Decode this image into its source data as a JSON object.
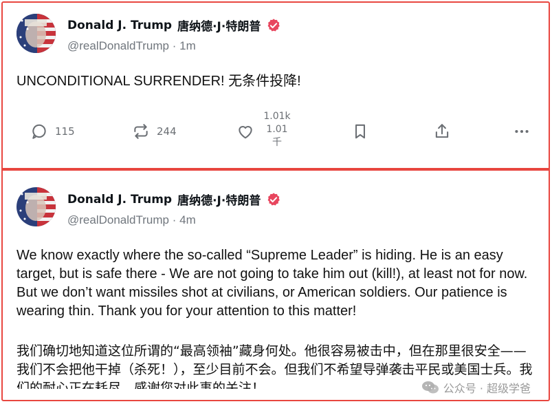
{
  "posts": [
    {
      "author": {
        "display_name": "Donald J. Trump",
        "display_name_zh": "唐纳德·J·特朗普",
        "handle": "@realDonaldTrump",
        "separator": "·",
        "time": "1m",
        "verified_icon": "verified-badge-icon"
      },
      "text": "UNCONDITIONAL SURRENDER!  无条件投降!",
      "actions": {
        "replies": "115",
        "reposts": "244",
        "likes_line1": "1.01k",
        "likes_line2": "1.01",
        "likes_line3": "千"
      }
    },
    {
      "author": {
        "display_name": "Donald J. Trump",
        "display_name_zh": "唐纳德·J·特朗普",
        "handle": "@realDonaldTrump",
        "separator": "·",
        "time": "4m",
        "verified_icon": "verified-badge-icon"
      },
      "text": "We know exactly where the so-called “Supreme Leader” is hiding. He is an easy target, but is safe there - We are not going to take him out (kill!), at least not for now. But we don’t want missiles shot at civilians, or American soldiers. Our patience is wearing thin. Thank you for your attention to this matter!",
      "text_zh": "我们确切地知道这位所谓的“最高领袖”藏身何处。他很容易被击中，但在那里很安全——我们不会把他干掉（杀死！），至少目前不会。但我们不希望导弹袭击平民或美国士兵。我们的耐心正在耗尽。感谢您对此事的关注！"
    }
  ],
  "watermark": {
    "text": "公众号 · 超级学爸"
  },
  "colors": {
    "frame_border": "#e8463f",
    "verified_badge": "#e8465e",
    "icon_gray": "#6b6f74",
    "handle_gray": "#70767d"
  }
}
